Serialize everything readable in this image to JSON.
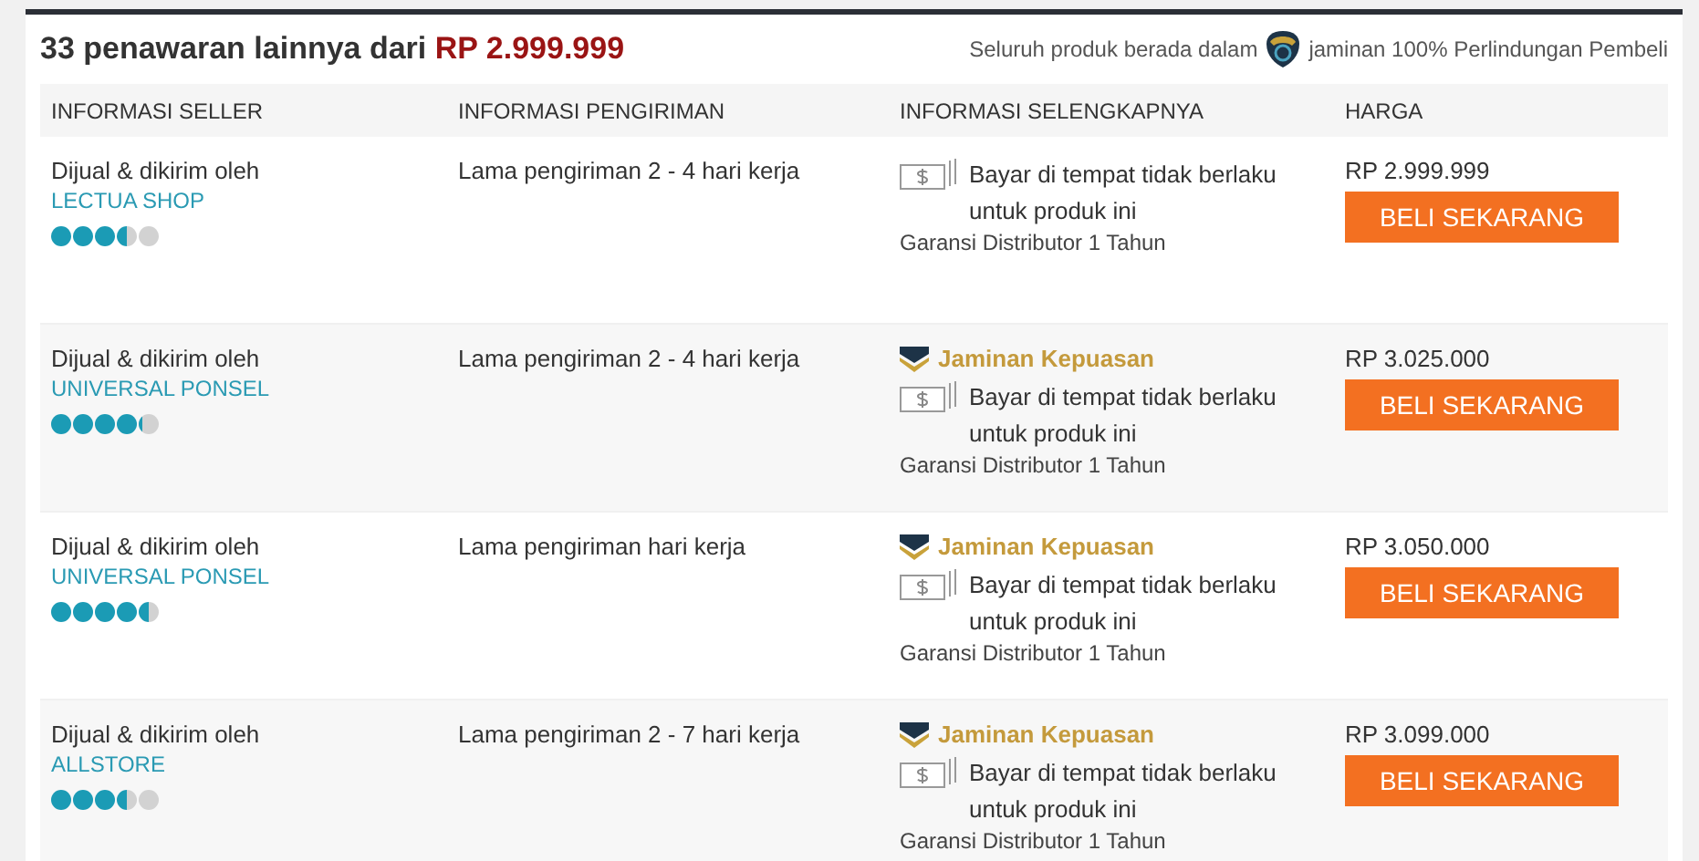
{
  "header": {
    "title": "33 penawaran lainnya dari ",
    "title_price": "RP 2.999.999",
    "protection_before": "Seluruh produk berada dalam",
    "protection_after": "jaminan 100% Perlindungan Pembeli"
  },
  "table": {
    "columns": [
      "INFORMASI SELLER",
      "INFORMASI PENGIRIMAN",
      "INFORMASI SELENGKAPNYA",
      "HARGA"
    ],
    "rows": [
      {
        "seller_label": "Dijual & dikirim oleh",
        "seller": "LECTUA SHOP",
        "stars": 3.5,
        "shipping": "Lama pengiriman 2 - 4 hari kerja",
        "cod": "Bayar di tempat tidak berlaku untuk produk ini",
        "warranty": "Garansi Distributor 1 Tahun",
        "price": "RP 2.999.999",
        "button": "BELI SEKARANG"
      },
      {
        "seller_label": "Dijual & dikirim oleh",
        "seller": "UNIVERSAL PONSEL",
        "stars": 4.2,
        "shipping": "Lama pengiriman 2 - 4 hari kerja",
        "guarantee": "Jaminan Kepuasan",
        "cod": "Bayar di tempat tidak berlaku untuk produk ini",
        "warranty": "Garansi Distributor 1 Tahun",
        "price": "RP 3.025.000",
        "button": "BELI SEKARANG"
      },
      {
        "seller_label": "Dijual & dikirim oleh",
        "seller": "UNIVERSAL PONSEL",
        "stars": 4.5,
        "shipping": "Lama pengiriman hari kerja",
        "guarantee": "Jaminan Kepuasan",
        "cod": "Bayar di tempat tidak berlaku untuk produk ini",
        "warranty": "Garansi Distributor 1 Tahun",
        "price": "RP 3.050.000",
        "button": "BELI SEKARANG"
      },
      {
        "seller_label": "Dijual & dikirim oleh",
        "seller": "ALLSTORE",
        "stars": 3.5,
        "shipping": "Lama pengiriman 2 - 7 hari kerja",
        "guarantee": "Jaminan Kepuasan",
        "cod": "Bayar di tempat tidak berlaku untuk produk ini",
        "warranty": "Garansi Distributor 1 Tahun",
        "price": "RP 3.099.000",
        "button": "BELI SEKARANG"
      }
    ]
  }
}
